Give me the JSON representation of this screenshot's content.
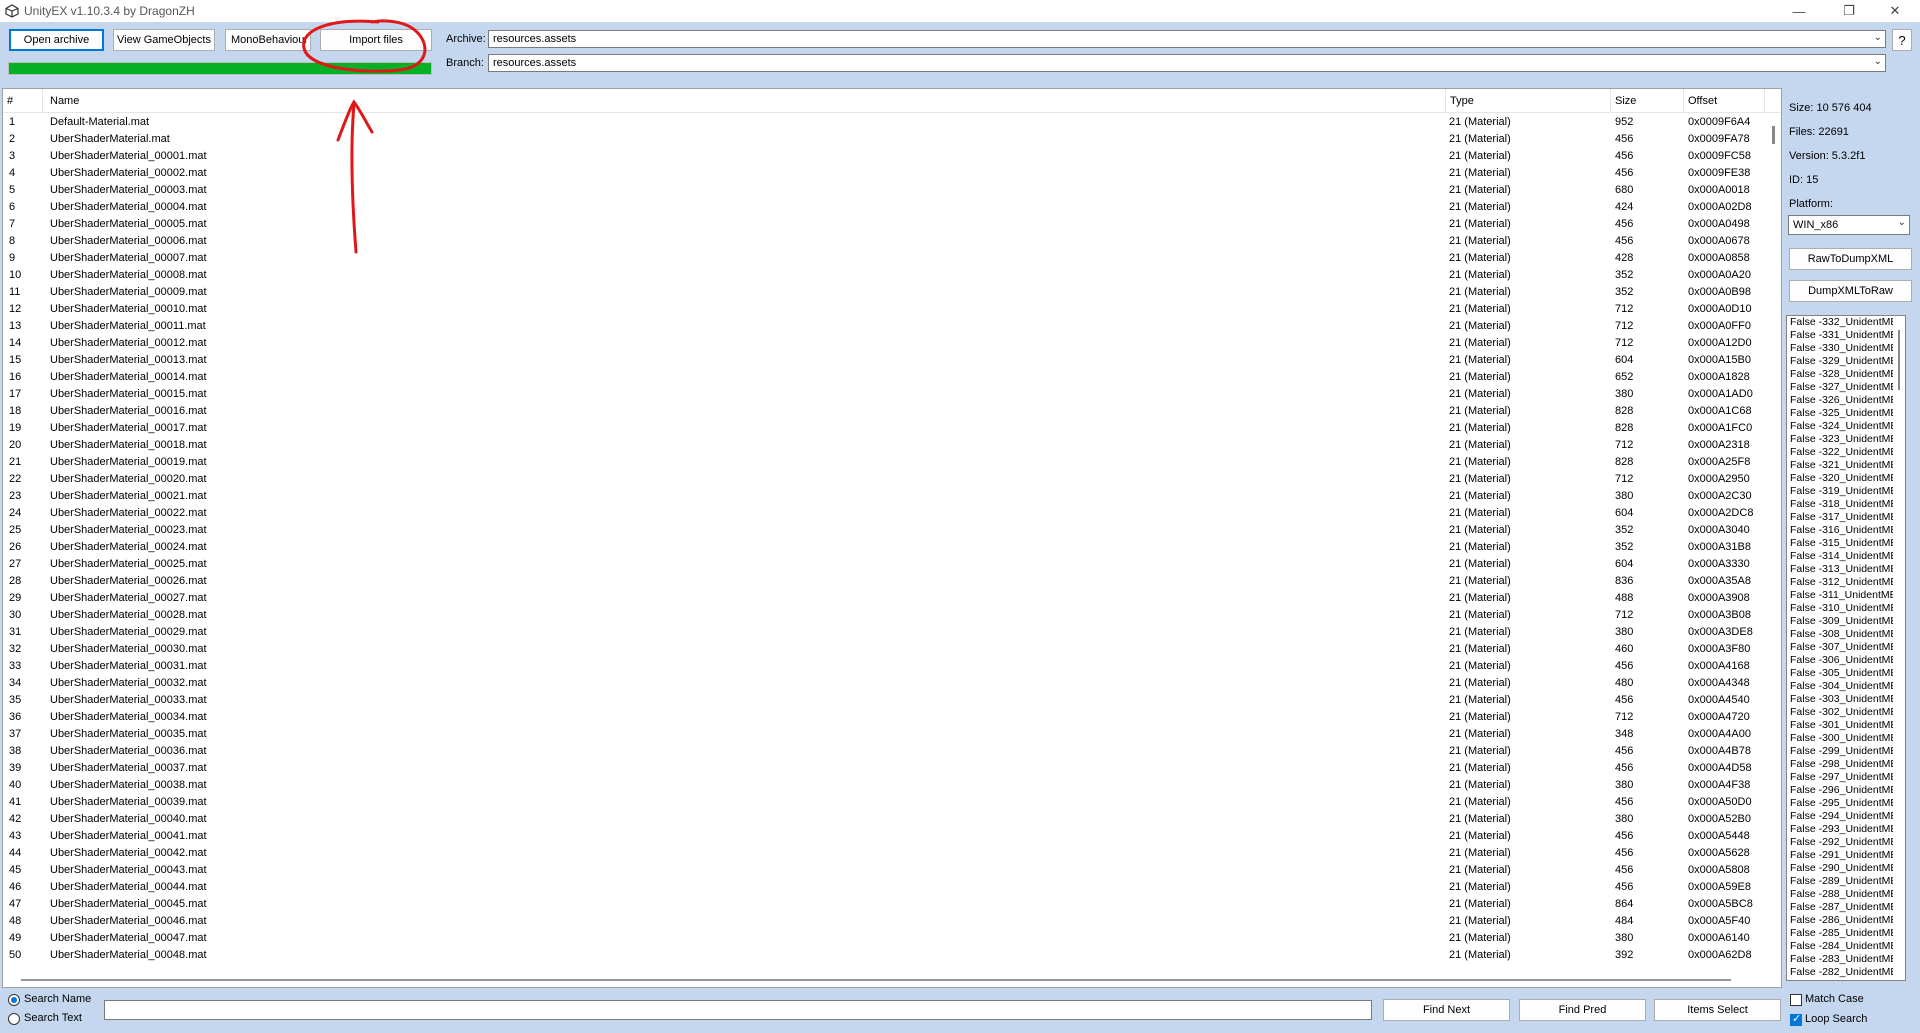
{
  "window": {
    "title": "UnityEX v1.10.3.4 by DragonZH",
    "minimize": "—",
    "maximize": "❐",
    "close": "✕"
  },
  "toolbar": {
    "open_archive": "Open archive",
    "view_gameobjects": "View GameObjects",
    "monobehaviour": "MonoBehaviour",
    "import_files": "Import files",
    "progress_percent": 100,
    "archive_label": "Archive:",
    "archive_value": "resources.assets",
    "branch_label": "Branch:",
    "branch_value": "resources.assets",
    "help": "?"
  },
  "list": {
    "headers": {
      "num": "#",
      "name": "Name",
      "type": "Type",
      "size": "Size",
      "offset": "Offset"
    },
    "rows": [
      [
        "1",
        "Default-Material.mat",
        "21 (Material)",
        "952",
        "0x0009F6A4"
      ],
      [
        "2",
        "UberShaderMaterial.mat",
        "21 (Material)",
        "456",
        "0x0009FA78"
      ],
      [
        "3",
        "UberShaderMaterial_00001.mat",
        "21 (Material)",
        "456",
        "0x0009FC58"
      ],
      [
        "4",
        "UberShaderMaterial_00002.mat",
        "21 (Material)",
        "456",
        "0x0009FE38"
      ],
      [
        "5",
        "UberShaderMaterial_00003.mat",
        "21 (Material)",
        "680",
        "0x000A0018"
      ],
      [
        "6",
        "UberShaderMaterial_00004.mat",
        "21 (Material)",
        "424",
        "0x000A02D8"
      ],
      [
        "7",
        "UberShaderMaterial_00005.mat",
        "21 (Material)",
        "456",
        "0x000A0498"
      ],
      [
        "8",
        "UberShaderMaterial_00006.mat",
        "21 (Material)",
        "456",
        "0x000A0678"
      ],
      [
        "9",
        "UberShaderMaterial_00007.mat",
        "21 (Material)",
        "428",
        "0x000A0858"
      ],
      [
        "10",
        "UberShaderMaterial_00008.mat",
        "21 (Material)",
        "352",
        "0x000A0A20"
      ],
      [
        "11",
        "UberShaderMaterial_00009.mat",
        "21 (Material)",
        "352",
        "0x000A0B98"
      ],
      [
        "12",
        "UberShaderMaterial_00010.mat",
        "21 (Material)",
        "712",
        "0x000A0D10"
      ],
      [
        "13",
        "UberShaderMaterial_00011.mat",
        "21 (Material)",
        "712",
        "0x000A0FF0"
      ],
      [
        "14",
        "UberShaderMaterial_00012.mat",
        "21 (Material)",
        "712",
        "0x000A12D0"
      ],
      [
        "15",
        "UberShaderMaterial_00013.mat",
        "21 (Material)",
        "604",
        "0x000A15B0"
      ],
      [
        "16",
        "UberShaderMaterial_00014.mat",
        "21 (Material)",
        "652",
        "0x000A1828"
      ],
      [
        "17",
        "UberShaderMaterial_00015.mat",
        "21 (Material)",
        "380",
        "0x000A1AD0"
      ],
      [
        "18",
        "UberShaderMaterial_00016.mat",
        "21 (Material)",
        "828",
        "0x000A1C68"
      ],
      [
        "19",
        "UberShaderMaterial_00017.mat",
        "21 (Material)",
        "828",
        "0x000A1FC0"
      ],
      [
        "20",
        "UberShaderMaterial_00018.mat",
        "21 (Material)",
        "712",
        "0x000A2318"
      ],
      [
        "21",
        "UberShaderMaterial_00019.mat",
        "21 (Material)",
        "828",
        "0x000A25F8"
      ],
      [
        "22",
        "UberShaderMaterial_00020.mat",
        "21 (Material)",
        "712",
        "0x000A2950"
      ],
      [
        "23",
        "UberShaderMaterial_00021.mat",
        "21 (Material)",
        "380",
        "0x000A2C30"
      ],
      [
        "24",
        "UberShaderMaterial_00022.mat",
        "21 (Material)",
        "604",
        "0x000A2DC8"
      ],
      [
        "25",
        "UberShaderMaterial_00023.mat",
        "21 (Material)",
        "352",
        "0x000A3040"
      ],
      [
        "26",
        "UberShaderMaterial_00024.mat",
        "21 (Material)",
        "352",
        "0x000A31B8"
      ],
      [
        "27",
        "UberShaderMaterial_00025.mat",
        "21 (Material)",
        "604",
        "0x000A3330"
      ],
      [
        "28",
        "UberShaderMaterial_00026.mat",
        "21 (Material)",
        "836",
        "0x000A35A8"
      ],
      [
        "29",
        "UberShaderMaterial_00027.mat",
        "21 (Material)",
        "488",
        "0x000A3908"
      ],
      [
        "30",
        "UberShaderMaterial_00028.mat",
        "21 (Material)",
        "712",
        "0x000A3B08"
      ],
      [
        "31",
        "UberShaderMaterial_00029.mat",
        "21 (Material)",
        "380",
        "0x000A3DE8"
      ],
      [
        "32",
        "UberShaderMaterial_00030.mat",
        "21 (Material)",
        "460",
        "0x000A3F80"
      ],
      [
        "33",
        "UberShaderMaterial_00031.mat",
        "21 (Material)",
        "456",
        "0x000A4168"
      ],
      [
        "34",
        "UberShaderMaterial_00032.mat",
        "21 (Material)",
        "480",
        "0x000A4348"
      ],
      [
        "35",
        "UberShaderMaterial_00033.mat",
        "21 (Material)",
        "456",
        "0x000A4540"
      ],
      [
        "36",
        "UberShaderMaterial_00034.mat",
        "21 (Material)",
        "712",
        "0x000A4720"
      ],
      [
        "37",
        "UberShaderMaterial_00035.mat",
        "21 (Material)",
        "348",
        "0x000A4A00"
      ],
      [
        "38",
        "UberShaderMaterial_00036.mat",
        "21 (Material)",
        "456",
        "0x000A4B78"
      ],
      [
        "39",
        "UberShaderMaterial_00037.mat",
        "21 (Material)",
        "456",
        "0x000A4D58"
      ],
      [
        "40",
        "UberShaderMaterial_00038.mat",
        "21 (Material)",
        "380",
        "0x000A4F38"
      ],
      [
        "41",
        "UberShaderMaterial_00039.mat",
        "21 (Material)",
        "456",
        "0x000A50D0"
      ],
      [
        "42",
        "UberShaderMaterial_00040.mat",
        "21 (Material)",
        "380",
        "0x000A52B0"
      ],
      [
        "43",
        "UberShaderMaterial_00041.mat",
        "21 (Material)",
        "456",
        "0x000A5448"
      ],
      [
        "44",
        "UberShaderMaterial_00042.mat",
        "21 (Material)",
        "456",
        "0x000A5628"
      ],
      [
        "45",
        "UberShaderMaterial_00043.mat",
        "21 (Material)",
        "456",
        "0x000A5808"
      ],
      [
        "46",
        "UberShaderMaterial_00044.mat",
        "21 (Material)",
        "456",
        "0x000A59E8"
      ],
      [
        "47",
        "UberShaderMaterial_00045.mat",
        "21 (Material)",
        "864",
        "0x000A5BC8"
      ],
      [
        "48",
        "UberShaderMaterial_00046.mat",
        "21 (Material)",
        "484",
        "0x000A5F40"
      ],
      [
        "49",
        "UberShaderMaterial_00047.mat",
        "21 (Material)",
        "380",
        "0x000A6140"
      ],
      [
        "50",
        "UberShaderMaterial_00048.mat",
        "21 (Material)",
        "392",
        "0x000A62D8"
      ]
    ]
  },
  "right_panel": {
    "size": "Size: 10 576 404",
    "files": "Files: 22691",
    "version": "Version: 5.3.2f1",
    "id": "ID: 15",
    "platform_label": "Platform:",
    "platform_value": "WIN_x86",
    "raw_to_dump": "RawToDumpXML",
    "dump_to_raw": "DumpXMLToRaw",
    "items": [
      "False -332_UnidentME",
      "False -331_UnidentME",
      "False -330_UnidentME",
      "False -329_UnidentME",
      "False -328_UnidentME",
      "False -327_UnidentME",
      "False -326_UnidentME",
      "False -325_UnidentME",
      "False -324_UnidentME",
      "False -323_UnidentME",
      "False -322_UnidentME",
      "False -321_UnidentME",
      "False -320_UnidentME",
      "False -319_UnidentME",
      "False -318_UnidentME",
      "False -317_UnidentME",
      "False -316_UnidentME",
      "False -315_UnidentME",
      "False -314_UnidentME",
      "False -313_UnidentME",
      "False -312_UnidentME",
      "False -311_UnidentME",
      "False -310_UnidentME",
      "False -309_UnidentME",
      "False -308_UnidentME",
      "False -307_UnidentME",
      "False -306_UnidentME",
      "False -305_UnidentME",
      "False -304_UnidentME",
      "False -303_UnidentME",
      "False -302_UnidentME",
      "False -301_UnidentME",
      "False -300_UnidentME",
      "False -299_UnidentME",
      "False -298_UnidentME",
      "False -297_UnidentME",
      "False -296_UnidentME",
      "False -295_UnidentME",
      "False -294_UnidentME",
      "False -293_UnidentME",
      "False -292_UnidentME",
      "False -291_UnidentME",
      "False -290_UnidentME",
      "False -289_UnidentME",
      "False -288_UnidentME",
      "False -287_UnidentME",
      "False -286_UnidentME",
      "False -285_UnidentME",
      "False -284_UnidentME",
      "False -283_UnidentME",
      "False -282_UnidentME"
    ]
  },
  "bottom": {
    "search_name": "Search Name",
    "search_text": "Search Text",
    "search_mode": "name",
    "search_value": "",
    "find_next": "Find Next",
    "find_pred": "Find Pred",
    "items_select": "Items Select",
    "match_case": "Match Case",
    "match_case_checked": false,
    "loop_search": "Loop Search",
    "loop_search_checked": true
  },
  "colors": {
    "background": "#c5d7ef",
    "progress_fill": "#06b025",
    "accent": "#0078d7",
    "annotation": "#e01818"
  },
  "icons": {
    "app": "unity-icon",
    "combo_arrow": "chevron-down-icon"
  }
}
